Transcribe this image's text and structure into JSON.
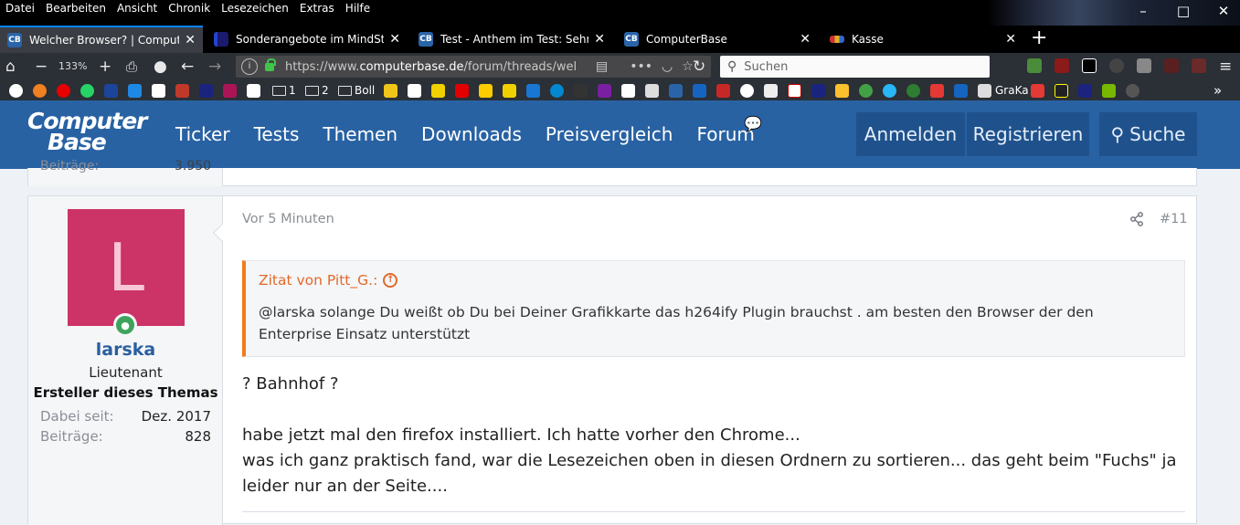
{
  "menu": [
    "Datei",
    "Bearbeiten",
    "Ansicht",
    "Chronik",
    "Lesezeichen",
    "Extras",
    "Hilfe"
  ],
  "window_controls": [
    "–",
    "□",
    "✕"
  ],
  "tabs": [
    {
      "title": "Welcher Browser? | ComputerB",
      "close": "✕",
      "favicon_color": "#2a64a8",
      "favicon": "CB"
    },
    {
      "title": "Sonderangebote im MindStar |",
      "close": "✕",
      "favicon_color": "#1a1a6e",
      "favicon": ""
    },
    {
      "title": "Test - Anthem im Test: Sehr sc",
      "close": "✕",
      "favicon_color": "#2a64a8",
      "favicon": "CB"
    },
    {
      "title": "ComputerBase",
      "close": "✕",
      "favicon_color": "#2a64a8",
      "favicon": "CB"
    },
    {
      "title": "Kasse",
      "close": "✕",
      "favicon_color": "#cc3333",
      "favicon": ""
    }
  ],
  "new_tab": "+",
  "nav": {
    "zoom": "133%",
    "url_prefix": "https://www.",
    "url_host": "computerbase.de",
    "url_path": "/forum/threads/wel",
    "search_placeholder": "Suchen"
  },
  "bookmarks": [
    {
      "label": "1",
      "type": "folder"
    },
    {
      "label": "2",
      "type": "folder"
    },
    {
      "label": "Boll",
      "type": "folder"
    },
    {
      "label": "GraKa",
      "type": "link"
    }
  ],
  "site": {
    "logo_line1": "Computer",
    "logo_line2": "Base",
    "nav": [
      "Ticker",
      "Tests",
      "Themen",
      "Downloads",
      "Preisvergleich",
      "Forum"
    ],
    "login": "Anmelden",
    "register": "Registrieren",
    "search": "Suche"
  },
  "prev_post": {
    "stat_label": "Beiträge:",
    "stat_value": "3.950"
  },
  "post": {
    "avatar_letter": "L",
    "avatar_color": "#cc3366",
    "username": "larska",
    "rank": "Lieutenant",
    "starter": "Ersteller dieses Themas",
    "joined_label": "Dabei seit:",
    "joined_value": "Dez. 2017",
    "posts_label": "Beiträge:",
    "posts_value": "828",
    "time": "Vor 5 Minuten",
    "number": "#11",
    "quote_author": "Zitat von Pitt_G.:",
    "quote_text": "@larska solange Du weißt ob Du bei Deiner Grafikkarte das h264ify Plugin brauchst . am besten den Browser der den Enterprise Einsatz unterstützt",
    "line1": "? Bahnhof ?",
    "line2": "habe jetzt mal den firefox installiert. Ich hatte vorher den Chrome...",
    "line3": "was ich ganz praktisch fand, war die Lesezeichen oben in diesen Ordnern zu sortieren... das geht beim \"Fuchs\" ja leider nur an der Seite...."
  }
}
